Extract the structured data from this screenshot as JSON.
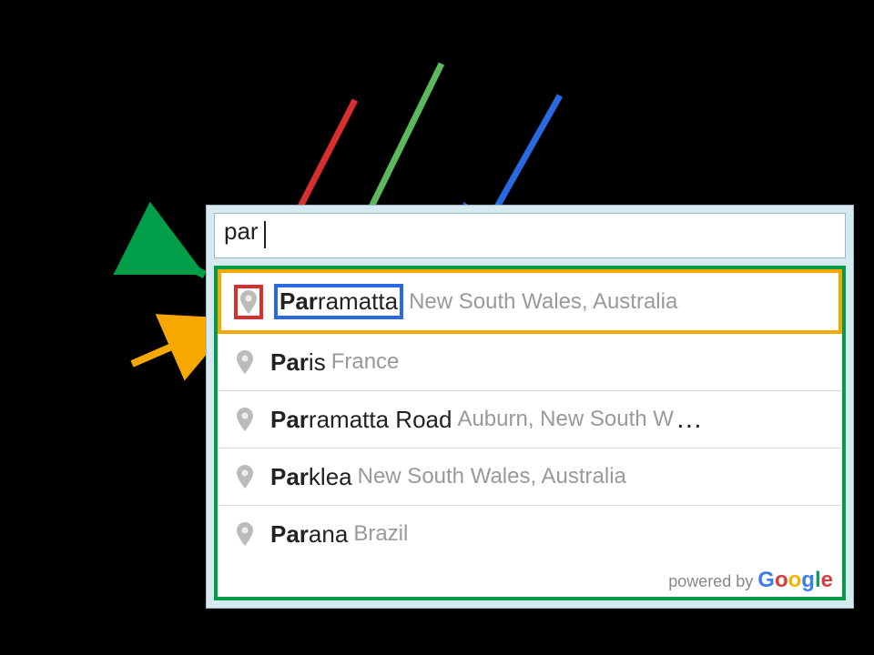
{
  "search": {
    "value": "par"
  },
  "predictions": [
    {
      "matched": "Par",
      "rest": "ramatta",
      "secondary": "New South Wales, Australia",
      "highlighted": true
    },
    {
      "matched": "Par",
      "rest": "is",
      "secondary": "France",
      "highlighted": false
    },
    {
      "matched": "Par",
      "rest": "ramatta Road",
      "secondary": "Auburn, New South W",
      "truncated": true,
      "highlighted": false
    },
    {
      "matched": "Par",
      "rest": "klea",
      "secondary": "New South Wales, Australia",
      "highlighted": false
    },
    {
      "matched": "Par",
      "rest": "ana",
      "secondary": "Brazil",
      "highlighted": false
    }
  ],
  "footer": {
    "prefix": "powered by "
  },
  "annotations": {
    "arrow_red": {
      "color": "#d92e2e"
    },
    "arrow_green": {
      "color": "#5cb85c"
    },
    "arrow_blue": {
      "color": "#2a6ae0"
    },
    "arrow_darkgreen": {
      "color": "#009e49"
    },
    "arrow_orange": {
      "color": "#f6a800"
    }
  },
  "highlight_colors": {
    "container": "#009e49",
    "item": "#f6a800",
    "icon": "#d92e2e",
    "term": "#2a6ae0"
  }
}
